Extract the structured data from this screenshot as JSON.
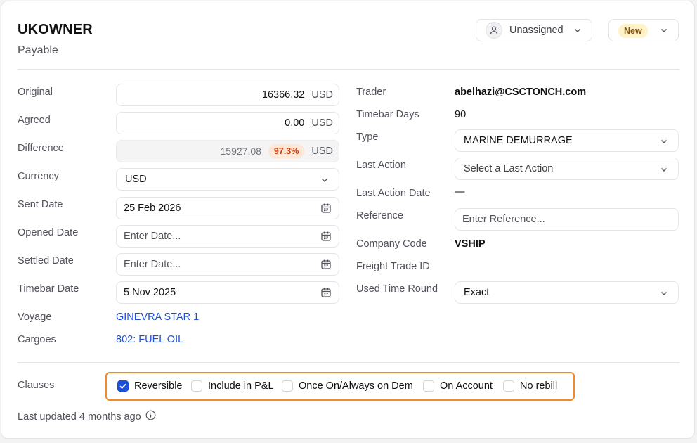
{
  "header": {
    "title": "UKOWNER",
    "subtitle": "Payable",
    "assignee": "Unassigned",
    "status": "New"
  },
  "left": {
    "original": {
      "label": "Original",
      "value": "16366.32",
      "unit": "USD"
    },
    "agreed": {
      "label": "Agreed",
      "value": "0.00",
      "unit": "USD"
    },
    "difference": {
      "label": "Difference",
      "value": "15927.08",
      "percent": "97.3%",
      "unit": "USD"
    },
    "currency": {
      "label": "Currency",
      "value": "USD"
    },
    "sent_date": {
      "label": "Sent Date",
      "value": "25 Feb 2026"
    },
    "opened_date": {
      "label": "Opened Date",
      "placeholder": "Enter Date..."
    },
    "settled_date": {
      "label": "Settled Date",
      "placeholder": "Enter Date..."
    },
    "timebar_date": {
      "label": "Timebar Date",
      "value": "5 Nov 2025"
    },
    "voyage": {
      "label": "Voyage",
      "value": "GINEVRA STAR 1"
    },
    "cargoes": {
      "label": "Cargoes",
      "value": "802: FUEL OIL"
    }
  },
  "right": {
    "trader": {
      "label": "Trader",
      "value": "abelhazi@CSCTONCH.com"
    },
    "timebar_days": {
      "label": "Timebar Days",
      "value": "90"
    },
    "type": {
      "label": "Type",
      "value": "MARINE DEMURRAGE"
    },
    "last_action": {
      "label": "Last Action",
      "placeholder": "Select a Last Action"
    },
    "last_action_date": {
      "label": "Last Action Date",
      "value": "—"
    },
    "reference": {
      "label": "Reference",
      "placeholder": "Enter Reference..."
    },
    "company_code": {
      "label": "Company Code",
      "value": "VSHIP"
    },
    "freight_trade_id": {
      "label": "Freight Trade ID"
    },
    "used_time_round": {
      "label": "Used Time Round",
      "value": "Exact"
    }
  },
  "clauses": {
    "label": "Clauses",
    "items": [
      {
        "label": "Reversible",
        "checked": true
      },
      {
        "label": "Include in P&L",
        "checked": false
      },
      {
        "label": "Once On/Always on Dem",
        "checked": false
      },
      {
        "label": "On Account",
        "checked": false
      },
      {
        "label": "No rebill",
        "checked": false
      }
    ]
  },
  "footer": {
    "last_updated": "Last updated 4 months ago"
  },
  "colors": {
    "accent": "#1d4ed8",
    "highlight": "#f08a2c",
    "status_bg": "#fef3c7",
    "percent_bg": "#fde7d6"
  }
}
